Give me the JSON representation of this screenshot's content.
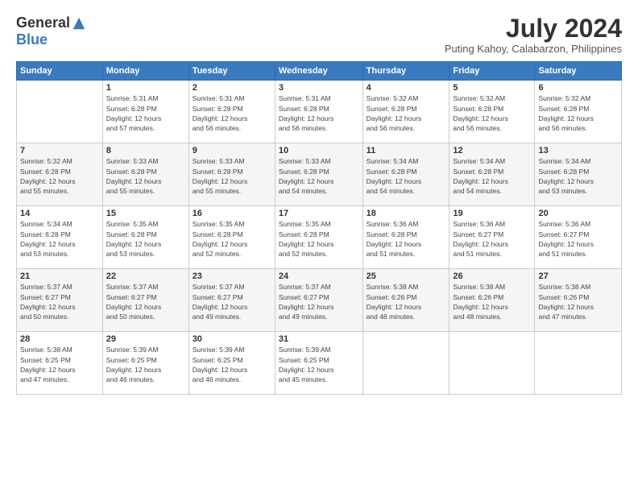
{
  "header": {
    "logo_general": "General",
    "logo_blue": "Blue",
    "month_year": "July 2024",
    "location": "Puting Kahoy, Calabarzon, Philippines"
  },
  "days_of_week": [
    "Sunday",
    "Monday",
    "Tuesday",
    "Wednesday",
    "Thursday",
    "Friday",
    "Saturday"
  ],
  "weeks": [
    [
      {
        "day": "",
        "info": ""
      },
      {
        "day": "1",
        "info": "Sunrise: 5:31 AM\nSunset: 6:28 PM\nDaylight: 12 hours\nand 57 minutes."
      },
      {
        "day": "2",
        "info": "Sunrise: 5:31 AM\nSunset: 6:28 PM\nDaylight: 12 hours\nand 56 minutes."
      },
      {
        "day": "3",
        "info": "Sunrise: 5:31 AM\nSunset: 6:28 PM\nDaylight: 12 hours\nand 56 minutes."
      },
      {
        "day": "4",
        "info": "Sunrise: 5:32 AM\nSunset: 6:28 PM\nDaylight: 12 hours\nand 56 minutes."
      },
      {
        "day": "5",
        "info": "Sunrise: 5:32 AM\nSunset: 6:28 PM\nDaylight: 12 hours\nand 56 minutes."
      },
      {
        "day": "6",
        "info": "Sunrise: 5:32 AM\nSunset: 6:28 PM\nDaylight: 12 hours\nand 56 minutes."
      }
    ],
    [
      {
        "day": "7",
        "info": "Sunrise: 5:32 AM\nSunset: 6:28 PM\nDaylight: 12 hours\nand 55 minutes."
      },
      {
        "day": "8",
        "info": "Sunrise: 5:33 AM\nSunset: 6:28 PM\nDaylight: 12 hours\nand 55 minutes."
      },
      {
        "day": "9",
        "info": "Sunrise: 5:33 AM\nSunset: 6:28 PM\nDaylight: 12 hours\nand 55 minutes."
      },
      {
        "day": "10",
        "info": "Sunrise: 5:33 AM\nSunset: 6:28 PM\nDaylight: 12 hours\nand 54 minutes."
      },
      {
        "day": "11",
        "info": "Sunrise: 5:34 AM\nSunset: 6:28 PM\nDaylight: 12 hours\nand 54 minutes."
      },
      {
        "day": "12",
        "info": "Sunrise: 5:34 AM\nSunset: 6:28 PM\nDaylight: 12 hours\nand 54 minutes."
      },
      {
        "day": "13",
        "info": "Sunrise: 5:34 AM\nSunset: 6:28 PM\nDaylight: 12 hours\nand 53 minutes."
      }
    ],
    [
      {
        "day": "14",
        "info": "Sunrise: 5:34 AM\nSunset: 6:28 PM\nDaylight: 12 hours\nand 53 minutes."
      },
      {
        "day": "15",
        "info": "Sunrise: 5:35 AM\nSunset: 6:28 PM\nDaylight: 12 hours\nand 53 minutes."
      },
      {
        "day": "16",
        "info": "Sunrise: 5:35 AM\nSunset: 6:28 PM\nDaylight: 12 hours\nand 52 minutes."
      },
      {
        "day": "17",
        "info": "Sunrise: 5:35 AM\nSunset: 6:28 PM\nDaylight: 12 hours\nand 52 minutes."
      },
      {
        "day": "18",
        "info": "Sunrise: 5:36 AM\nSunset: 6:28 PM\nDaylight: 12 hours\nand 51 minutes."
      },
      {
        "day": "19",
        "info": "Sunrise: 5:36 AM\nSunset: 6:27 PM\nDaylight: 12 hours\nand 51 minutes."
      },
      {
        "day": "20",
        "info": "Sunrise: 5:36 AM\nSunset: 6:27 PM\nDaylight: 12 hours\nand 51 minutes."
      }
    ],
    [
      {
        "day": "21",
        "info": "Sunrise: 5:37 AM\nSunset: 6:27 PM\nDaylight: 12 hours\nand 50 minutes."
      },
      {
        "day": "22",
        "info": "Sunrise: 5:37 AM\nSunset: 6:27 PM\nDaylight: 12 hours\nand 50 minutes."
      },
      {
        "day": "23",
        "info": "Sunrise: 5:37 AM\nSunset: 6:27 PM\nDaylight: 12 hours\nand 49 minutes."
      },
      {
        "day": "24",
        "info": "Sunrise: 5:37 AM\nSunset: 6:27 PM\nDaylight: 12 hours\nand 49 minutes."
      },
      {
        "day": "25",
        "info": "Sunrise: 5:38 AM\nSunset: 6:26 PM\nDaylight: 12 hours\nand 48 minutes."
      },
      {
        "day": "26",
        "info": "Sunrise: 5:38 AM\nSunset: 6:26 PM\nDaylight: 12 hours\nand 48 minutes."
      },
      {
        "day": "27",
        "info": "Sunrise: 5:38 AM\nSunset: 6:26 PM\nDaylight: 12 hours\nand 47 minutes."
      }
    ],
    [
      {
        "day": "28",
        "info": "Sunrise: 5:38 AM\nSunset: 6:25 PM\nDaylight: 12 hours\nand 47 minutes."
      },
      {
        "day": "29",
        "info": "Sunrise: 5:39 AM\nSunset: 6:25 PM\nDaylight: 12 hours\nand 46 minutes."
      },
      {
        "day": "30",
        "info": "Sunrise: 5:39 AM\nSunset: 6:25 PM\nDaylight: 12 hours\nand 46 minutes."
      },
      {
        "day": "31",
        "info": "Sunrise: 5:39 AM\nSunset: 6:25 PM\nDaylight: 12 hours\nand 45 minutes."
      },
      {
        "day": "",
        "info": ""
      },
      {
        "day": "",
        "info": ""
      },
      {
        "day": "",
        "info": ""
      }
    ]
  ]
}
